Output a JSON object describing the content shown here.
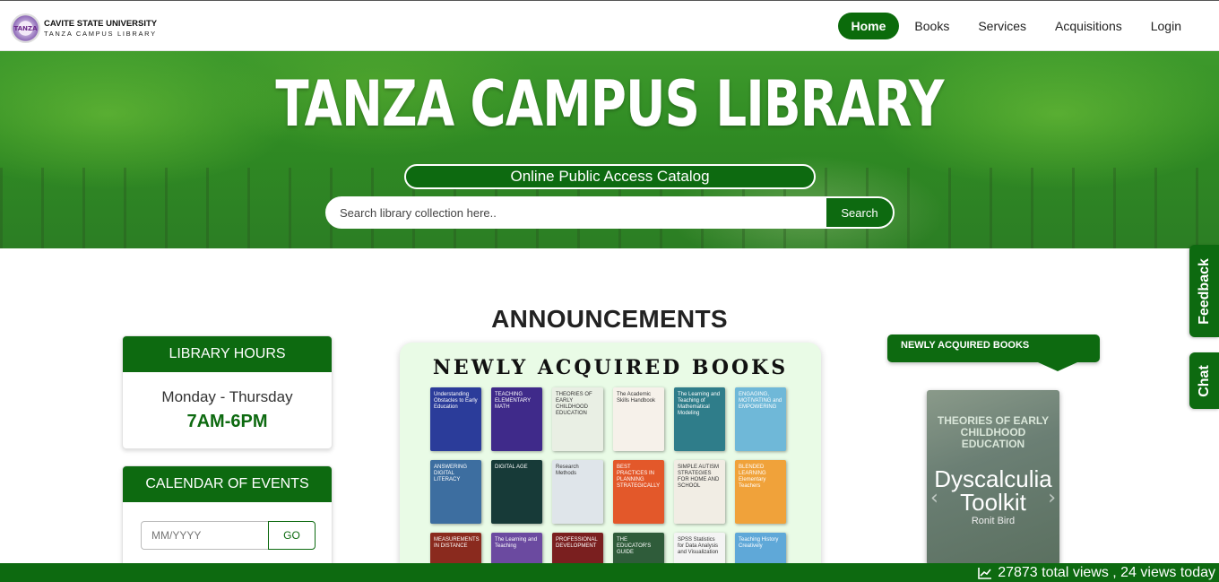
{
  "brand": {
    "seal_text": "TANZA",
    "university": "CAVITE STATE UNIVERSITY",
    "library": "TANZA CAMPUS LIBRARY"
  },
  "nav": {
    "items": [
      {
        "label": "Home",
        "active": true
      },
      {
        "label": "Books",
        "active": false
      },
      {
        "label": "Services",
        "active": false
      },
      {
        "label": "Acquisitions",
        "active": false
      },
      {
        "label": "Login",
        "active": false
      }
    ]
  },
  "hero": {
    "title": "TANZA CAMPUS LIBRARY",
    "subtitle": "Online Public Access Catalog",
    "search_placeholder": "Search library collection here..",
    "search_button": "Search"
  },
  "announcements": {
    "title": "ANNOUNCEMENTS",
    "poster_title": "NEWLY ACQUIRED BOOKS",
    "books": [
      {
        "title": "Understanding Obstacles to Early Education",
        "color": "#2b3c9a"
      },
      {
        "title": "TEACHING ELEMENTARY MATH",
        "color": "#3f2a8a"
      },
      {
        "title": "THEORIES OF EARLY CHILDHOOD EDUCATION",
        "color": "#e9efe4"
      },
      {
        "title": "The Academic Skills Handbook",
        "color": "#f6f1ea"
      },
      {
        "title": "The Learning and Teaching of Mathematical Modeling",
        "color": "#2f7d8a"
      },
      {
        "title": "ENGAGING, MOTIVATING and EMPOWERING",
        "color": "#6fb8d8"
      },
      {
        "title": "ANSWERING DIGITAL LITERACY",
        "color": "#3d6ea0"
      },
      {
        "title": "DIGITAL AGE",
        "color": "#173a38"
      },
      {
        "title": "Research Methods",
        "color": "#dfe5ea"
      },
      {
        "title": "BEST PRACTICES IN PLANNING STRATEGICALLY",
        "color": "#e3582a"
      },
      {
        "title": "SIMPLE AUTISM STRATEGIES FOR HOME AND SCHOOL",
        "color": "#f1ede4"
      },
      {
        "title": "BLENDED LEARNING Elementary Teachers",
        "color": "#f0a23a"
      },
      {
        "title": "MEASUREMENTS IN DISTANCE",
        "color": "#8a2a1e"
      },
      {
        "title": "The Learning and Teaching",
        "color": "#6b4aa0"
      },
      {
        "title": "PROFESSIONAL DEVELOPMENT",
        "color": "#7a1f1f"
      },
      {
        "title": "THE EDUCATOR'S GUIDE",
        "color": "#2f5c3a"
      },
      {
        "title": "SPSS Statistics for Data Analysis and Visualization",
        "color": "#f4f4f4"
      },
      {
        "title": "Teaching History Creatively",
        "color": "#5fa8d8"
      }
    ]
  },
  "library_hours": {
    "title": "LIBRARY HOURS",
    "days": "Monday - Thursday",
    "time": "7AM-6PM"
  },
  "calendar": {
    "title": "CALENDAR OF EVENTS",
    "placeholder": "MM/YYYY",
    "go_label": "GO"
  },
  "newly_acquired": {
    "title": "NEWLY ACQUIRED BOOKS",
    "book_overlay_top": "THEORIES OF EARLY CHILDHOOD EDUCATION",
    "book_title": "Dyscalculia Toolkit",
    "book_author": "Ronit Bird"
  },
  "side_tabs": {
    "feedback": "Feedback",
    "chat": "Chat"
  },
  "footer": {
    "views": "27873 total views , 24 views today"
  },
  "colors": {
    "brand_green": "#0d6a10",
    "poster_bg": "#e9fbe6"
  }
}
